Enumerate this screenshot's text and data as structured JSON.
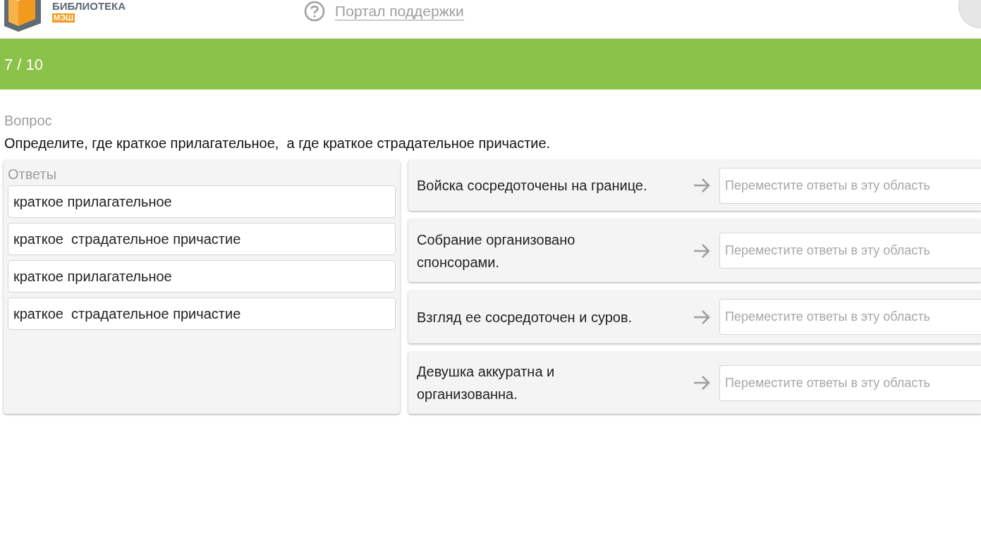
{
  "header": {
    "logo_title": "БИБЛИОТЕКА",
    "logo_badge": "МЭШ",
    "support_link": "Портал поддержки"
  },
  "progress": {
    "counter": "7 / 10"
  },
  "question": {
    "label": "Вопрос",
    "text": "Определите, где краткое прилагательное,  а где краткое страдательное причастие."
  },
  "answers": {
    "title": "Ответы",
    "items": [
      "краткое прилагательное",
      "краткое  страдательное причастие",
      "краткое прилагательное",
      "краткое  страдательное причастие"
    ]
  },
  "targets": [
    {
      "statement": "Войска сосредоточены на границе.",
      "placeholder": "Переместите ответы в эту область"
    },
    {
      "statement": "Собрание организовано спонсорами.",
      "placeholder": "Переместите ответы в эту область"
    },
    {
      "statement": "Взгляд ее сосредоточен и суров.",
      "placeholder": "Переместите ответы в эту область"
    },
    {
      "statement": "Девушка аккуратна и организованна.",
      "placeholder": "Переместите ответы в эту область"
    }
  ]
}
